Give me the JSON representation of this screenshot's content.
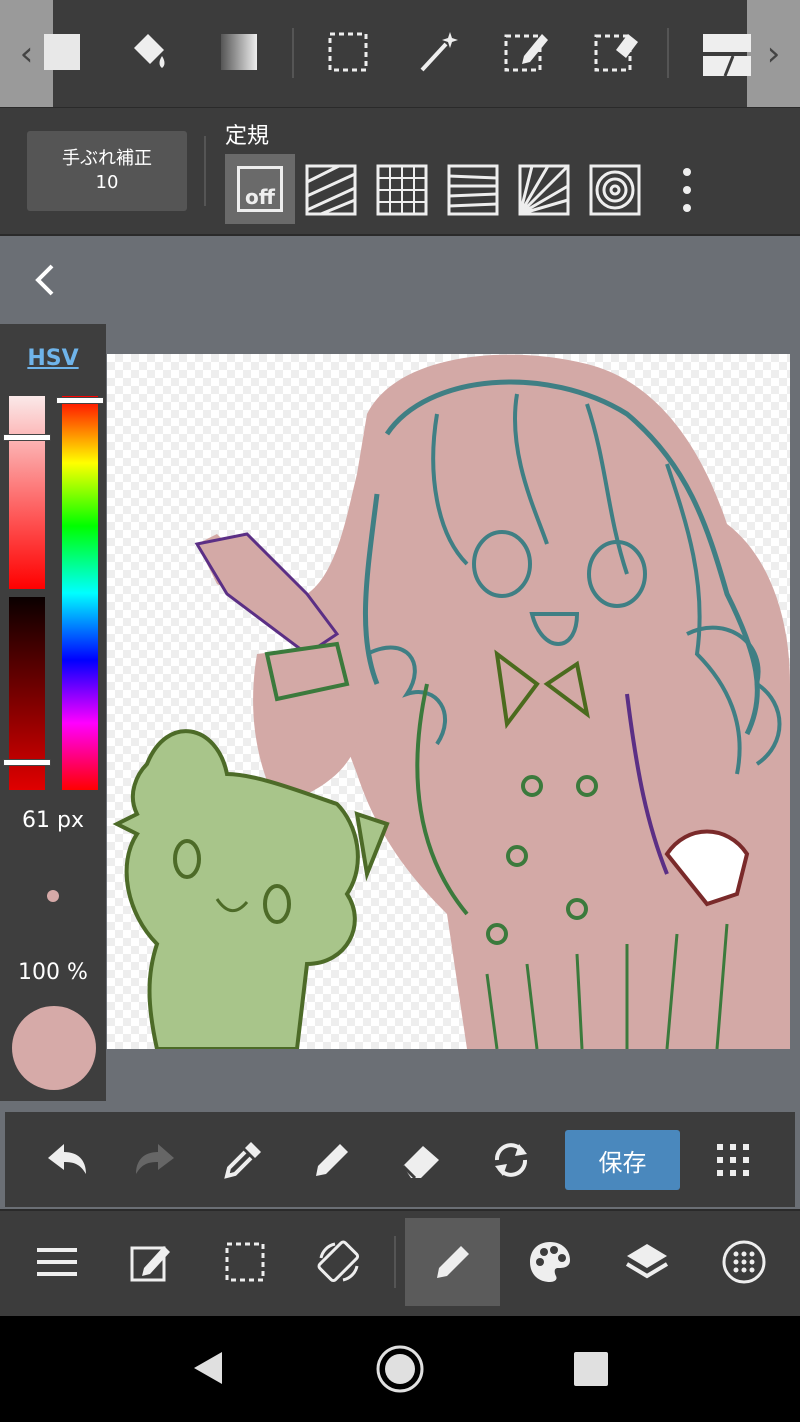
{
  "top_toolbar": {
    "scroll_left": "‹",
    "scroll_right": "›",
    "tools": [
      "fill-color-icon",
      "bucket-icon",
      "gradient-icon",
      "select-rect-icon",
      "magic-wand-icon",
      "select-pen-icon",
      "select-eraser-icon",
      "frame-divide-icon"
    ]
  },
  "sub_toolbar": {
    "stabilizer_label": "手ぶれ補正",
    "stabilizer_value": "10",
    "ruler_title": "定規",
    "ruler_off_label": "off"
  },
  "color_panel": {
    "mode_link": "HSV",
    "brush_size": "61 px",
    "opacity": "100 %",
    "current_color": "#d6aaa8",
    "saturation_level": 0.22,
    "value_level": 0.85,
    "hue_level": 0.0
  },
  "action_bar": {
    "save_label": "保存"
  },
  "colors": {
    "toolbar_bg": "#3c3c3c",
    "canvas_area_bg": "#6b6f75",
    "accent_blue": "#4a88bd",
    "link_blue": "#6fb4ea"
  }
}
